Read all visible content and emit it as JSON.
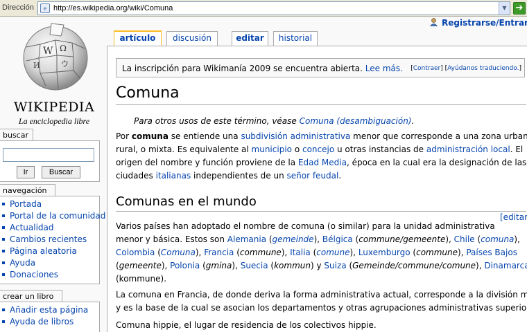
{
  "browser": {
    "address_label": "Dirección",
    "url": "http://es.wikipedia.org/wiki/Comuna",
    "go_icon": "go-arrow-icon"
  },
  "logo": {
    "wordmark": "WIKIPEDIA",
    "tagline": "La enciclopedia libre"
  },
  "user": {
    "register_label": "Registrarse/Entrar"
  },
  "tabs": [
    {
      "label": "artículo",
      "active": true
    },
    {
      "label": "discusión"
    },
    {
      "label": "editar"
    },
    {
      "label": "historial"
    }
  ],
  "search": {
    "title": "buscar",
    "go_label": "Ir",
    "search_label": "Buscar",
    "value": ""
  },
  "navigation": {
    "title": "navegación",
    "items": [
      "Portada",
      "Portal de la comunidad",
      "Actualidad",
      "Cambios recientes",
      "Página aleatoria",
      "Ayuda",
      "Donaciones"
    ]
  },
  "create_book": {
    "title": "crear un libro",
    "items": [
      "Añadir esta página",
      "Ayuda de libros"
    ]
  },
  "notice": {
    "text": "La inscripción para Wikimanía 2009 se encuentra abierta.",
    "link": "Lee más.",
    "hide": "Contraer",
    "translate": "Ayúdanos traduciendo."
  },
  "article": {
    "title": "Comuna",
    "dab_prefix": "Para otros usos de este término, véase",
    "dab_link": "Comuna (desambiguación)",
    "dab_suffix": ".",
    "intro": {
      "l1": {
        "a": "Por ",
        "b": "comuna",
        "c": " se entiende una ",
        "d": "subdivisión administrativa",
        "e": " menor que corresponde a una zona urbana o"
      },
      "l2": {
        "a": "rural, o mixta. Es equivalente al ",
        "b": "municipio",
        "c": " o ",
        "d": "concejo",
        "e": " u otras instancias de ",
        "f": "administración local",
        "g": ". El"
      },
      "l3": {
        "a": "origen del nombre y función proviene de la ",
        "b": "Edad Media",
        "c": ", época en la cual era la designación de las"
      },
      "l4": {
        "a": "ciudades ",
        "b": "italianas",
        "c": " independientes de un ",
        "d": "señor feudal",
        "e": "."
      }
    },
    "section_title": "Comunas en el mundo",
    "edit_label": "[editar]",
    "world": {
      "l1": "Varios países han adoptado el nombre de comuna (o similar) para la unidad administrativa",
      "l2": {
        "a": "menor y básica. Estos son ",
        "b": "Alemania",
        "c": " (",
        "d": "gemeinde",
        "e": "), ",
        "f": "Bélgica",
        "g": " (",
        "h": "commune/gemeente",
        "i": "), ",
        "j": "Chile",
        "k": " (",
        "l": "comuna",
        "m": "),"
      },
      "l3": {
        "a": "Colombia",
        "b": " (",
        "c": "Comuna",
        "d": "), ",
        "e": "Francia",
        "f": " (",
        "g": "commune",
        "h": "), ",
        "i": "Italia",
        "j": " (",
        "k": "comune",
        "l": "), ",
        "m": "Luxemburgo",
        "n": " (",
        "o": "commune",
        "p": "), ",
        "q": "Países Bajos"
      },
      "l4": {
        "a": "(",
        "b": "gemeente",
        "c": "), ",
        "d": "Polonia",
        "e": " (",
        "f": "gmina",
        "g": "), ",
        "h": "Suecia",
        "i": " (",
        "j": "kommun",
        "k": ") y ",
        "l": "Suiza",
        "m": " (",
        "n": "Gemeinde/commune/comune",
        "o": "), ",
        "p": "Dinamarca"
      },
      "l5": "(kommune)."
    },
    "france": {
      "l1": "La comuna en Francia, de donde deriva la forma administrativa actual, corresponde a la división menor",
      "l2": "y es la base de la cual se asocian los departamentos y otras agrupaciones administrativas superiores."
    },
    "hippie": "Comuna hippie, el lugar de residencia de los colectivos hippie."
  }
}
